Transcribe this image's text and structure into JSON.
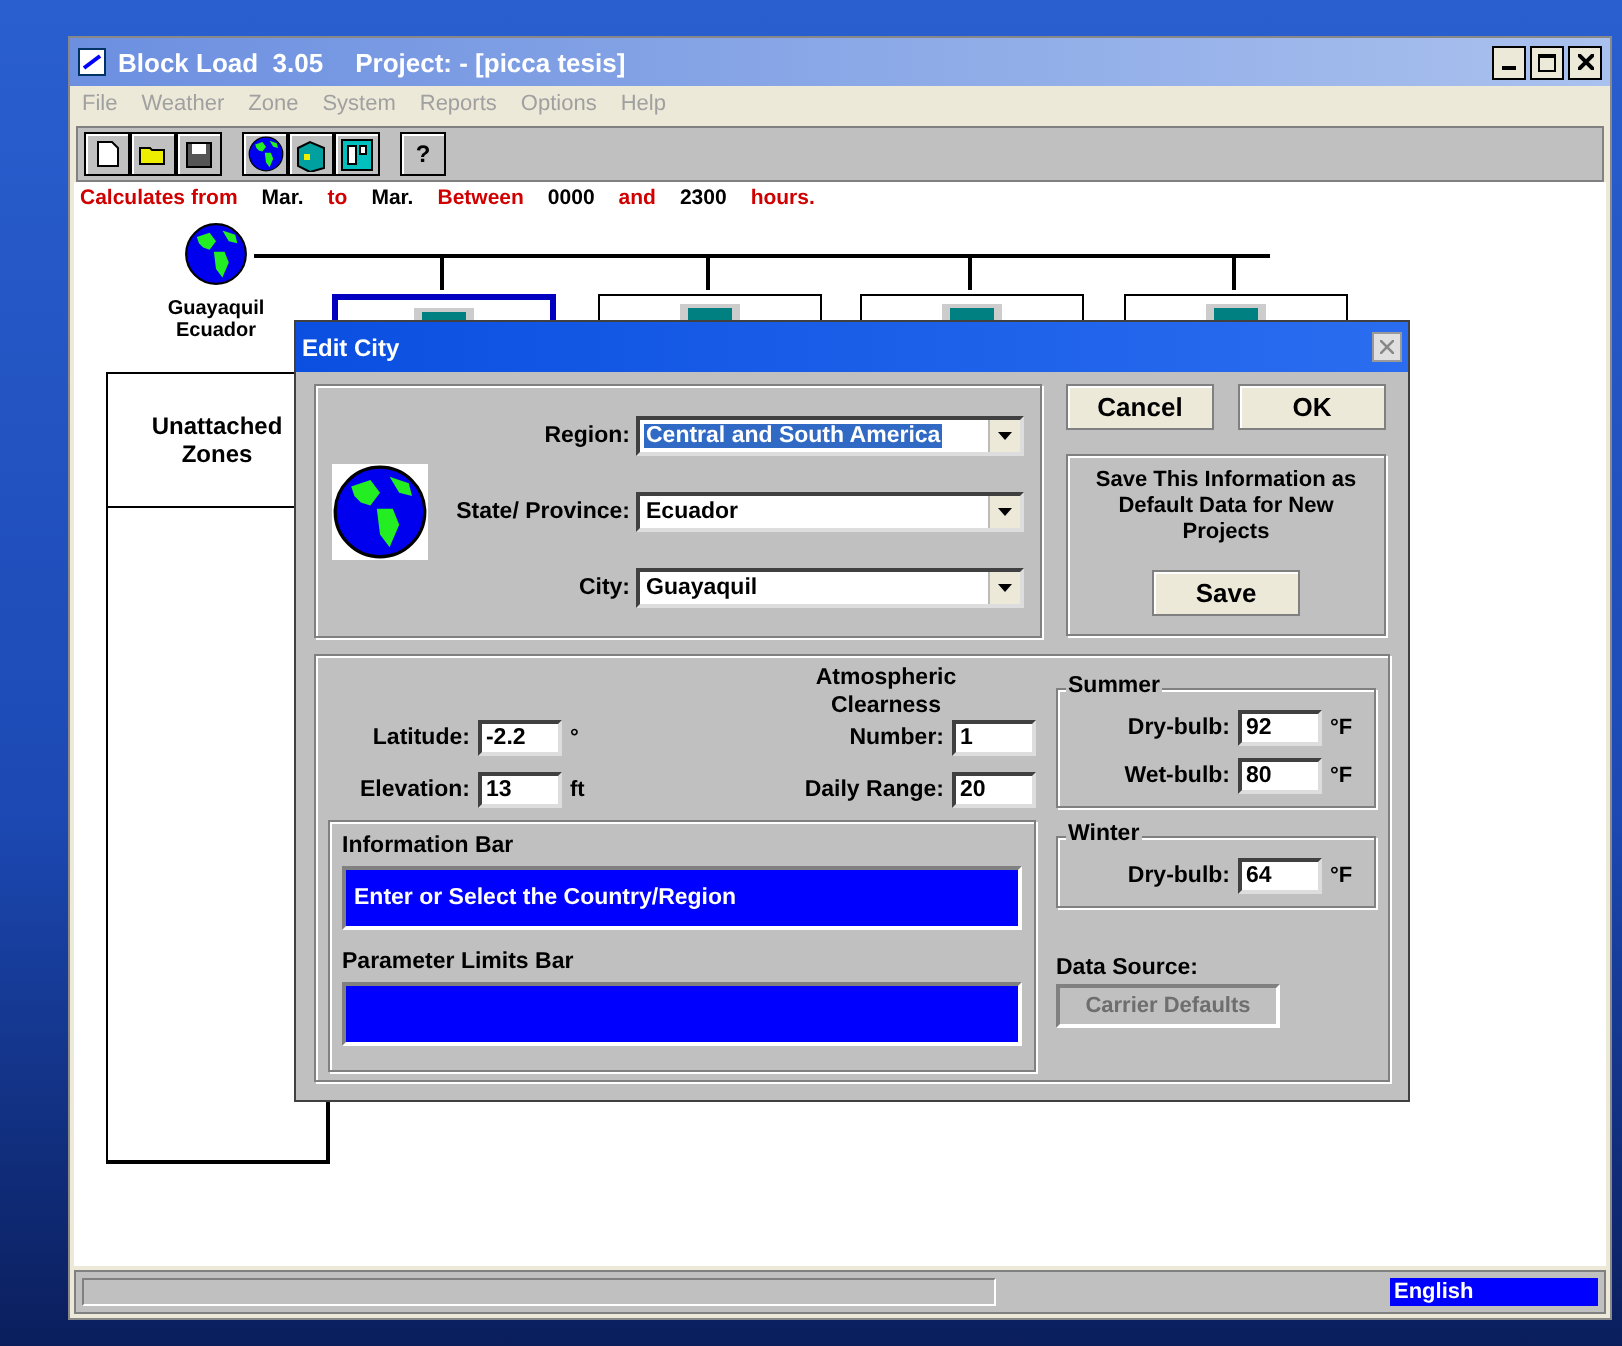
{
  "window": {
    "title": "Block Load  3.05",
    "project": "Project: - [picca tesis]"
  },
  "menu": [
    {
      "label": "File",
      "disabled": true
    },
    {
      "label": "Weather",
      "disabled": true
    },
    {
      "label": "Zone",
      "disabled": true
    },
    {
      "label": "System",
      "disabled": true
    },
    {
      "label": "Reports",
      "disabled": true
    },
    {
      "label": "Options",
      "disabled": true
    },
    {
      "label": "Help",
      "disabled": true
    }
  ],
  "toolbar": [
    {
      "kind": "new"
    },
    {
      "kind": "open"
    },
    {
      "kind": "save"
    },
    {
      "kind": "gap"
    },
    {
      "kind": "globe"
    },
    {
      "kind": "building"
    },
    {
      "kind": "zone"
    },
    {
      "kind": "gap"
    },
    {
      "kind": "text",
      "label": "?"
    }
  ],
  "calc_line": [
    {
      "kind": "label",
      "text": "Calculates from"
    },
    {
      "kind": "value",
      "text": "Mar."
    },
    {
      "kind": "label",
      "text": "to"
    },
    {
      "kind": "value",
      "text": "Mar."
    },
    {
      "kind": "label",
      "text": "Between"
    },
    {
      "kind": "value",
      "text": "0000"
    },
    {
      "kind": "label",
      "text": "and"
    },
    {
      "kind": "value",
      "text": "2300"
    },
    {
      "kind": "label",
      "text": "hours."
    }
  ],
  "diagram": {
    "city": "Guayaquil",
    "country": "Ecuador",
    "zones": [
      {
        "selected": true
      },
      {
        "selected": false
      },
      {
        "selected": false
      },
      {
        "selected": false
      }
    ],
    "unattached": "Unattached Zones"
  },
  "dialog": {
    "title": "Edit City",
    "location_fields": [
      {
        "label": "Region:",
        "value": "Central and South America",
        "highlighted": true
      },
      {
        "label": "State/ Province:",
        "value": "Ecuador",
        "highlighted": false
      },
      {
        "label": "City:",
        "value": "Guayaquil",
        "highlighted": false
      }
    ],
    "buttons": [
      "Cancel",
      "OK"
    ],
    "save_note": "Save This Information as Default Data for New Projects",
    "save_button": "Save",
    "left_params": [
      {
        "label": "Latitude:",
        "value": "-2.2",
        "unit": "°"
      },
      {
        "label": "Elevation:",
        "value": "13",
        "unit": "ft"
      }
    ],
    "atmos_heading": "Atmospheric Clearness",
    "right_params": [
      {
        "label": "Number:",
        "value": "1"
      },
      {
        "label": "Daily Range:",
        "value": "20"
      }
    ],
    "summer": {
      "title": "Summer",
      "rows": [
        {
          "label": "Dry-bulb:",
          "value": "92",
          "unit": "°F"
        },
        {
          "label": "Wet-bulb:",
          "value": "80",
          "unit": "°F"
        }
      ]
    },
    "winter": {
      "title": "Winter",
      "rows": [
        {
          "label": "Dry-bulb:",
          "value": "64",
          "unit": "°F"
        }
      ]
    },
    "information_bar": {
      "title": "Information Bar",
      "text": "Enter or Select the Country/Region"
    },
    "parameter_limits_bar": {
      "title": "Parameter Limits Bar"
    },
    "data_source": {
      "label": "Data Source:",
      "button": "Carrier Defaults",
      "disabled": true
    }
  },
  "status_bar": {
    "language": "English"
  }
}
